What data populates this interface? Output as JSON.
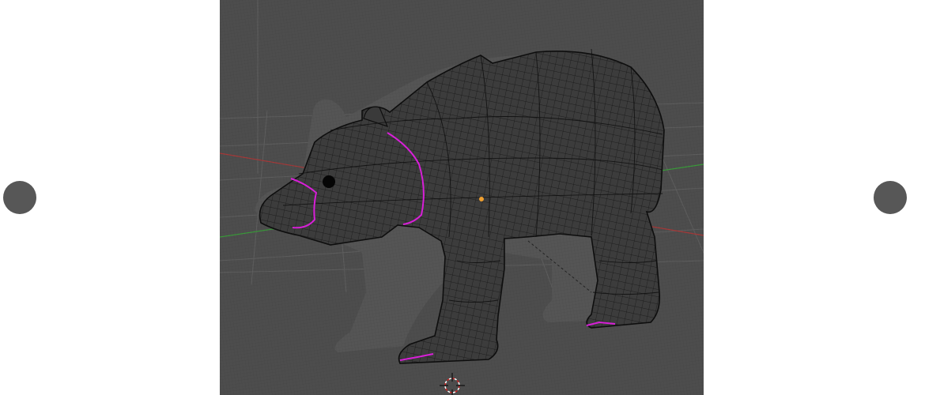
{
  "viewer": {
    "prev_button": "previous",
    "next_button": "next"
  },
  "viewport": {
    "background_color": "#4d4d4d",
    "grid_color": "#5e5e5e",
    "x_axis_color": "#a83838",
    "y_axis_color": "#3a9a3a",
    "mesh_fill_color": "#3c3c3c",
    "wire_color": "#111111",
    "seam_color": "#d81fd8",
    "ghost_color": "#555555",
    "origin_color": "#f0a030",
    "cursor_colors": [
      "#d02020",
      "#ffffff"
    ]
  },
  "icons": {
    "prev": "circle-nav-icon",
    "next": "circle-nav-icon",
    "cursor": "3d-cursor-icon",
    "origin": "object-origin-icon"
  }
}
